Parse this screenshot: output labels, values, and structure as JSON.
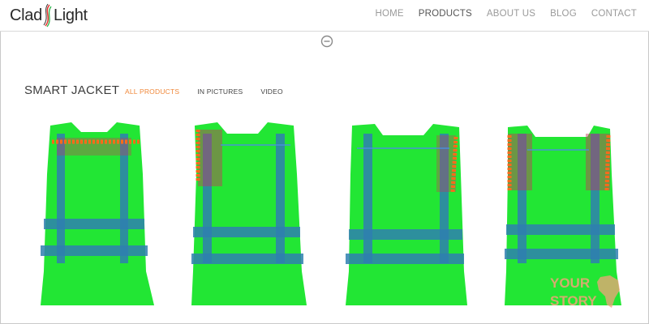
{
  "brand": {
    "name_left": "Clad",
    "name_right": "Light"
  },
  "nav": {
    "items": [
      {
        "label": "HOME",
        "active": false
      },
      {
        "label": "PRODUCTS",
        "active": true
      },
      {
        "label": "ABOUT US",
        "active": false
      },
      {
        "label": "BLOG",
        "active": false
      },
      {
        "label": "CONTACT",
        "active": false
      }
    ]
  },
  "section": {
    "title": "SMART JACKET",
    "filters": [
      {
        "label": "ALL PRODUCTS",
        "active": true
      },
      {
        "label": "IN PICTURES",
        "active": false
      },
      {
        "label": "VIDEO",
        "active": false
      }
    ]
  },
  "gallery": {
    "items": [
      {
        "icon": "vest-front-collar-leds"
      },
      {
        "icon": "vest-left-shoulder-leds"
      },
      {
        "icon": "vest-right-shoulder-leds"
      },
      {
        "icon": "vest-both-shoulder-leds"
      }
    ]
  },
  "watermark": {
    "line1": "YOUR",
    "line2": "STORY"
  },
  "colors": {
    "accent": "#f0883a",
    "nav_text": "#9a9a9a",
    "vest_green": "#22e634",
    "vest_stripe": "#2f7fb0",
    "led": "#ff6a1a"
  }
}
